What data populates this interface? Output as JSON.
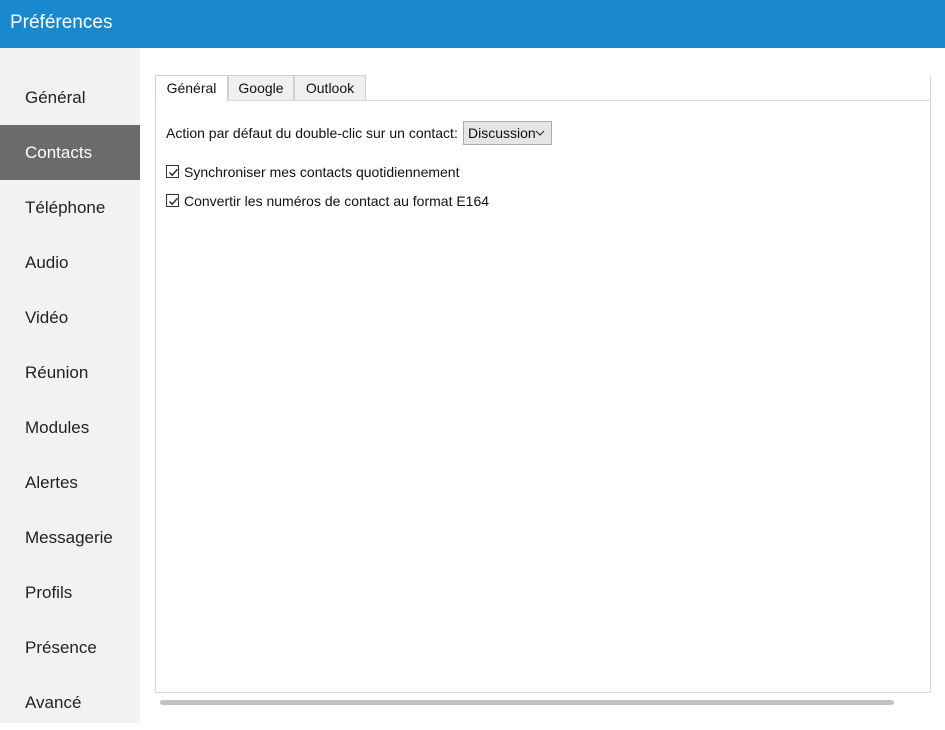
{
  "window": {
    "title": "Préférences"
  },
  "sidebar": {
    "items": [
      {
        "label": "Général"
      },
      {
        "label": "Contacts"
      },
      {
        "label": "Téléphone"
      },
      {
        "label": "Audio"
      },
      {
        "label": "Vidéo"
      },
      {
        "label": "Réunion"
      },
      {
        "label": "Modules"
      },
      {
        "label": "Alertes"
      },
      {
        "label": "Messagerie"
      },
      {
        "label": "Profils"
      },
      {
        "label": "Présence"
      },
      {
        "label": "Avancé"
      }
    ],
    "active": "Contacts"
  },
  "tabs": [
    {
      "label": "Général"
    },
    {
      "label": "Google"
    },
    {
      "label": "Outlook"
    }
  ],
  "active_tab": "Général",
  "general": {
    "double_click_label": "Action par défaut du double-clic sur un contact:",
    "double_click_value": "Discussion",
    "sync_daily_label": "Synchroniser mes contacts quotidiennement",
    "sync_daily_checked": true,
    "convert_e164_label": "Convertir les numéros de contact au format E164",
    "convert_e164_checked": true
  },
  "colors": {
    "titlebar": "#1a88cc",
    "sidebar_bg": "#f2f2f2",
    "sidebar_active": "#6b6b6b"
  }
}
